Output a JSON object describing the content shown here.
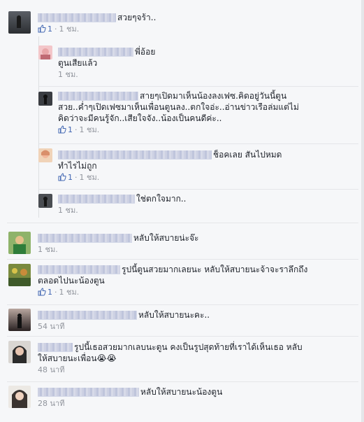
{
  "comments": [
    {
      "text": "สวยๆจร้า..",
      "likes": "1",
      "time": "1 ชม."
    },
    {
      "text": "พี่อ้อย",
      "text2": "ตูนเสียแล้ว",
      "time": "1 ชม."
    },
    {
      "text": "สายๆเปิดมาเห็นน้องลงเฟซ.คิดอยู่วันนี้ตูน",
      "text2": "สวย..ค่ำๆเปิดเฟซมาเห็นเพื่อนตูนลง..ตกใจอ่ะ..อ่านข่าวเรือล่มแต่ไม่",
      "text3": "คิดว่าจะมีคนรู้จัก..เสียใจจัง..น้องเป็นคนดีค่ะ..",
      "likes": "1",
      "time": "1 ชม."
    },
    {
      "text": "ช็อคเลย สันไปหมด",
      "text2": "ทำไรไม่ถูก",
      "likes": "1",
      "time": "1 ชม."
    },
    {
      "text": "ใช่ตกใจมาก..",
      "time": "1 ชม."
    },
    {
      "text": "หลับให้สบายน่ะจ๊ะ",
      "time": "1 ชม."
    },
    {
      "text": "รูปนี้ตูนสวยมากเลยนะ หลับให้สบายนะจ้าจะราลึกถึง",
      "text2": "ตลอดไปนะน้องตูน",
      "likes": "1",
      "time": "1 ชม."
    },
    {
      "text": "หลับให้สบายนะคะ..",
      "time": "54 นาที"
    },
    {
      "text": "รูปนี้เธอสวยมากเลบนะตูน คงเป็นรูปสุดท้ายที่เราได้เห็นเธอ หลับ",
      "text2": "ให้สบายนะเพื่อน😭😭",
      "time": "48 นาที"
    },
    {
      "text": "หลับให้สบายนะน้องตูน",
      "time": "28 นาที"
    }
  ],
  "colors": {
    "link": "#4267b2",
    "meta": "#90949c",
    "text": "#1d2129",
    "divider": "#e5e6e9"
  },
  "icons": {
    "like": "thumbs-up-icon"
  }
}
